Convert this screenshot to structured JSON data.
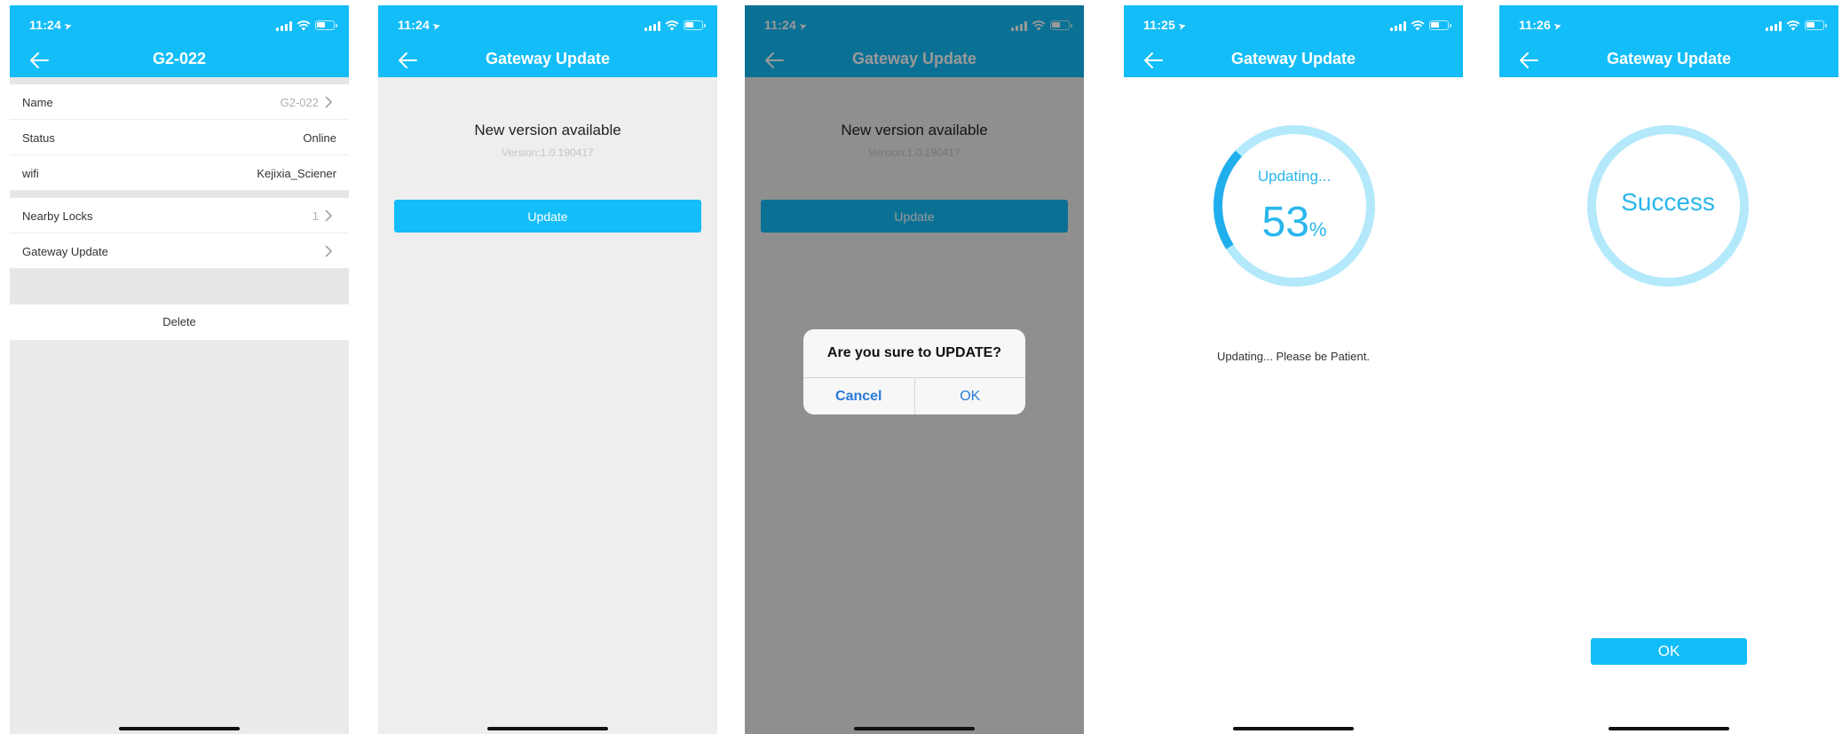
{
  "colors": {
    "accent": "#13bdf7",
    "ring_light": "#b3e9fb",
    "ring_active": "#21aeed",
    "alert_button": "#2a7ad9"
  },
  "phone1": {
    "status_time": "11:24",
    "title": "G2-022",
    "rows": [
      {
        "label": "Name",
        "value": "G2-022"
      },
      {
        "label": "Status",
        "value": "Online"
      },
      {
        "label": "wifi",
        "value": "Kejixia_Sciener"
      },
      {
        "label": "Nearby Locks",
        "value": "1"
      },
      {
        "label": "Gateway Update",
        "value": ""
      }
    ],
    "delete_label": "Delete"
  },
  "phone2": {
    "status_time": "11:24",
    "title": "Gateway Update",
    "heading": "New version available",
    "version": "Version:1.0.190417",
    "update_label": "Update"
  },
  "phone3": {
    "status_time": "11:24",
    "title": "Gateway Update",
    "heading": "New version available",
    "version": "Version:1.0.190417",
    "update_label": "Update",
    "alert": {
      "title": "Are you sure to UPDATE?",
      "cancel_label": "Cancel",
      "ok_label": "OK"
    }
  },
  "phone4": {
    "status_time": "11:25",
    "title": "Gateway Update",
    "progress_label": "Updating...",
    "progress_value": "53",
    "progress_unit": "%",
    "progress_fraction": 0.53,
    "message": "Updating... Please be Patient."
  },
  "phone5": {
    "status_time": "11:26",
    "title": "Gateway Update",
    "success_label": "Success",
    "ok_label": "OK"
  }
}
